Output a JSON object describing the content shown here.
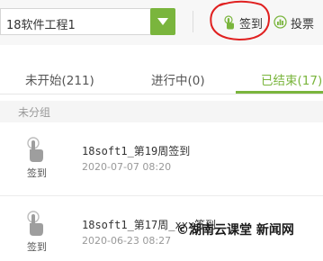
{
  "topbar": {
    "class_select_value": "18软件工程1",
    "checkin_label": "签到",
    "vote_label": "投票"
  },
  "tabs": [
    {
      "label": "未开始(211)"
    },
    {
      "label": "进行中(0)"
    },
    {
      "label": "已结束(17)"
    }
  ],
  "group_header": "未分组",
  "activities": [
    {
      "type": "签到",
      "title": "18soft1_第19周签到",
      "time": "2020-07-07 08:20"
    },
    {
      "type": "签到",
      "title": "18soft1_第17周_xxx签到",
      "time": "2020-06-23 08:27"
    }
  ],
  "watermark": "©湖南云课堂 新闻网",
  "colors": {
    "accent": "#7ab53d",
    "annotation": "#e02020"
  }
}
